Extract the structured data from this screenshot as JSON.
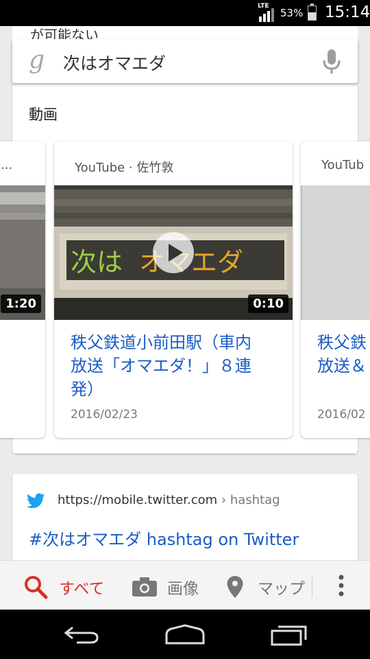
{
  "status_bar": {
    "network": "LTE",
    "battery_percent": "53%",
    "battery_level": 0.53,
    "time": "15:14"
  },
  "top_peek": {
    "text": "が可能ない"
  },
  "search": {
    "query": "次はオマエダ",
    "logo": "g"
  },
  "video_section": {
    "heading": "動画",
    "cards": [
      {
        "source": "e...",
        "duration": "1:20",
        "title": "",
        "date": ""
      },
      {
        "source": "YouTube · 佐竹敦",
        "duration": "0:10",
        "title_line1": "秩父鉄道小前田駅（車内",
        "title_line2": "放送「オマエダ！」８連",
        "title_line3": "発）",
        "date": "2016/02/23",
        "thumb_text": "次は オマエダ"
      },
      {
        "source": "YouTub",
        "title_line1": "秩父鉄",
        "title_line2": "放送＆",
        "date": "2016/02"
      }
    ]
  },
  "twitter_result": {
    "url": "https://mobile.twitter.com",
    "breadcrumb": "› hashtag",
    "title": "#次はオマエダ hashtag on Twitter"
  },
  "tabs": {
    "all": "すべて",
    "images": "画像",
    "maps": "マップ"
  },
  "colors": {
    "link": "#1a5cc8",
    "active_tab": "#d93025",
    "twitter": "#1da1f2"
  }
}
